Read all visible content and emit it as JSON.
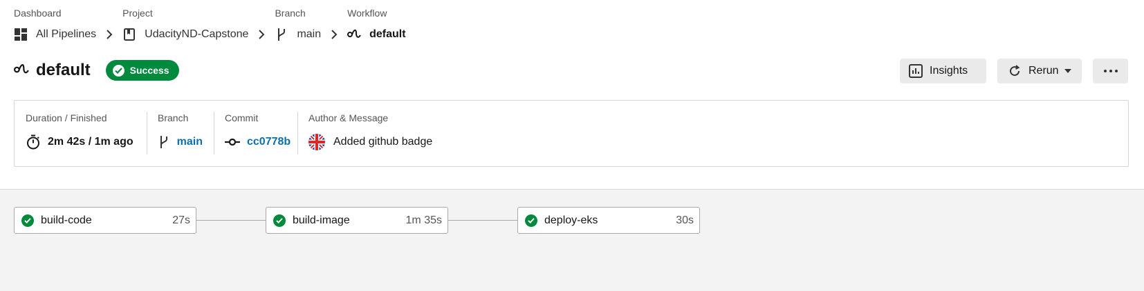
{
  "breadcrumbs": [
    {
      "label": "Dashboard",
      "value": "All Pipelines",
      "icon": "dashboard-icon"
    },
    {
      "label": "Project",
      "value": "UdacityND-Capstone",
      "icon": "project-icon"
    },
    {
      "label": "Branch",
      "value": "main",
      "icon": "branch-icon"
    },
    {
      "label": "Workflow",
      "value": "default",
      "icon": "workflow-icon"
    }
  ],
  "header": {
    "title": "default",
    "status": "Success"
  },
  "actions": {
    "insights_label": "Insights",
    "rerun_label": "Rerun"
  },
  "info": {
    "duration_label": "Duration / Finished",
    "duration_value": "2m 42s / 1m ago",
    "branch_label": "Branch",
    "branch_value": "main",
    "commit_label": "Commit",
    "commit_value": "cc0778b",
    "author_label": "Author & Message",
    "author_message": "Added github badge"
  },
  "jobs": [
    {
      "name": "build-code",
      "duration": "27s",
      "status": "success"
    },
    {
      "name": "build-image",
      "duration": "1m 35s",
      "status": "success"
    },
    {
      "name": "deploy-eks",
      "duration": "30s",
      "status": "success"
    }
  ],
  "colors": {
    "success": "#008a3d",
    "link": "#0b6eae",
    "button_bg": "#eaeaea"
  }
}
